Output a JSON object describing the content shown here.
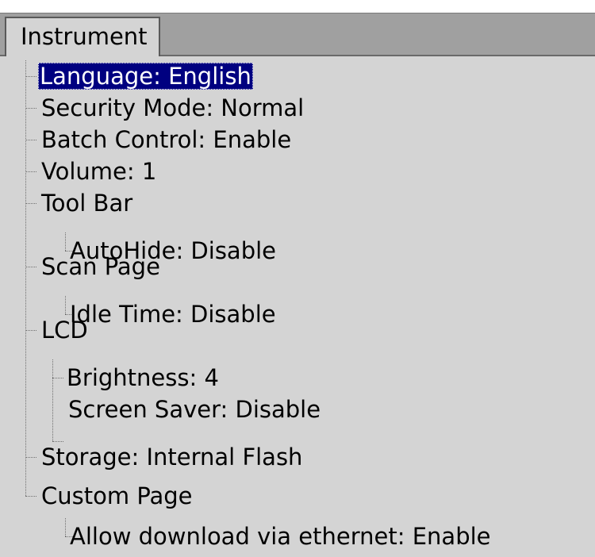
{
  "window": {
    "tab_label": "Instrument"
  },
  "tree": {
    "selected_index": 0,
    "items": [
      {
        "label": "Language: English",
        "level": 0
      },
      {
        "label": "Security Mode: Normal",
        "level": 0
      },
      {
        "label": "Batch Control: Enable",
        "level": 0
      },
      {
        "label": "Volume: 1",
        "level": 0
      },
      {
        "label": "Tool Bar",
        "level": 0
      },
      {
        "label": "AutoHide: Disable",
        "level": 1
      },
      {
        "label": "Scan Page",
        "level": 0
      },
      {
        "label": "Idle Time: Disable",
        "level": 1
      },
      {
        "label": "LCD",
        "level": 0
      },
      {
        "label": "Brightness: 4",
        "level": 1
      },
      {
        "label": "Screen Saver: Disable",
        "level": 1
      },
      {
        "label": "Storage: Internal Flash",
        "level": 0
      },
      {
        "label": "Custom Page",
        "level": 0
      },
      {
        "label": "Allow download via ethernet: Enable",
        "level": 1
      }
    ]
  },
  "colors": {
    "background": "#d4d4d4",
    "tab_bar": "#a0a0a0",
    "selection": "#000080"
  }
}
